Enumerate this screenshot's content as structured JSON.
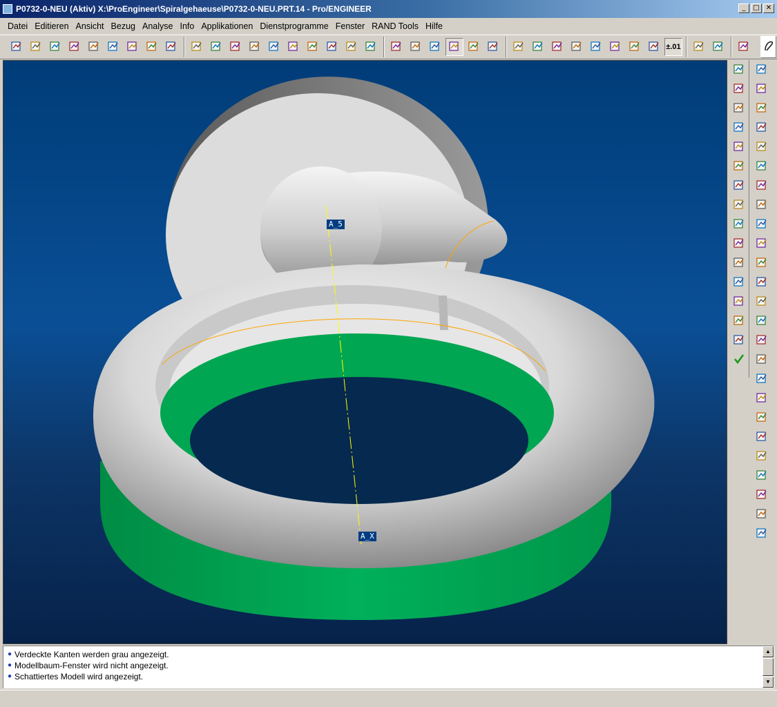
{
  "window": {
    "title": "P0732-0-NEU (Aktiv)  X:\\ProEngineer\\Spiralgehaeuse\\P0732-0-NEU.PRT.14 - Pro/ENGINEER",
    "controls": {
      "minimize": "_",
      "maximize": "□",
      "close": "✕"
    }
  },
  "menubar": {
    "items": [
      "Datei",
      "Editieren",
      "Ansicht",
      "Bezug",
      "Analyse",
      "Info",
      "Applikationen",
      "Dienstprogramme",
      "Fenster",
      "RAND Tools",
      "Hilfe"
    ]
  },
  "toolbar": {
    "groups": [
      [
        "new-from-template-icon",
        "open-draft-icon",
        "edit-icon",
        "new-document-icon",
        "open-folder-icon",
        "erase-icon",
        "save-icon",
        "save-copy-icon",
        "print-icon"
      ],
      [
        "repaint-icon",
        "zoom-in-icon",
        "zoom-out-icon",
        "refit-icon",
        "orient-icon",
        "saved-views-icon",
        "layers-icon",
        "layer-stack-icon",
        "model-tree-icon",
        "spin-center-icon"
      ],
      [
        "wireframe-icon",
        "hidden-line-icon",
        "no-hidden-icon",
        "shading-icon",
        "color-appearance-icon",
        "environment-globe-icon"
      ],
      [
        "datum-planes-icon",
        "datum-axes-icon",
        "datum-points-icon",
        "coordinate-systems-icon",
        "datum-display-icon",
        "annotation-icon",
        "view-manager-icon",
        "note-icon"
      ],
      [
        "window-activate-icon",
        "window-close-icon"
      ],
      [
        "context-help-icon"
      ]
    ],
    "dimension_label": "±.01"
  },
  "viewport": {
    "background_top": "#003c78",
    "background_bottom": "#06224a",
    "axis_labels": {
      "a5": "A_5",
      "ax": "A_X"
    },
    "colors": {
      "body": "#e4e4e4",
      "ring": "#00a651",
      "edge": "#ffa500",
      "axis": "#ffff00"
    }
  },
  "side_left": {
    "icons": [
      "dimension-icon",
      "hide-icon",
      "table-icon",
      "spacing-icon",
      "datum-refs-icon",
      "cut-icon",
      "protrusion-icon",
      "hatch-icon",
      "h-info-icon",
      "plane-sketch-icon",
      "constraint-icon",
      "spline-icon",
      "point-cross-icon",
      "point-multi-icon",
      "hierarchy-icon",
      "done-check-icon"
    ]
  },
  "side_right": {
    "icons": [
      "insert-feature-icon",
      "copy-feature-icon",
      "new-feature-icon",
      "redefine-feature-icon",
      "sketch-feature-icon",
      "pattern-feature-icon",
      "hole-icon",
      "datum-axis-feature-icon",
      "shaft-icon",
      "cosmetic-thread-icon",
      "rib-icon",
      "round-icon",
      "draft-icon",
      "chamfer-icon",
      "shell-icon",
      "slot-icon",
      "cut-feature-icon",
      "flange-icon",
      "neck-icon",
      "ear-icon",
      "lip-icon",
      "pipe-icon",
      "tweak-icon",
      "revolve-icon",
      "sweep-icon"
    ]
  },
  "messages": {
    "lines": [
      "Verdeckte Kanten werden grau angezeigt.",
      "Modellbaum-Fenster wird nicht angezeigt.",
      "Schattiertes Modell wird angezeigt."
    ]
  }
}
